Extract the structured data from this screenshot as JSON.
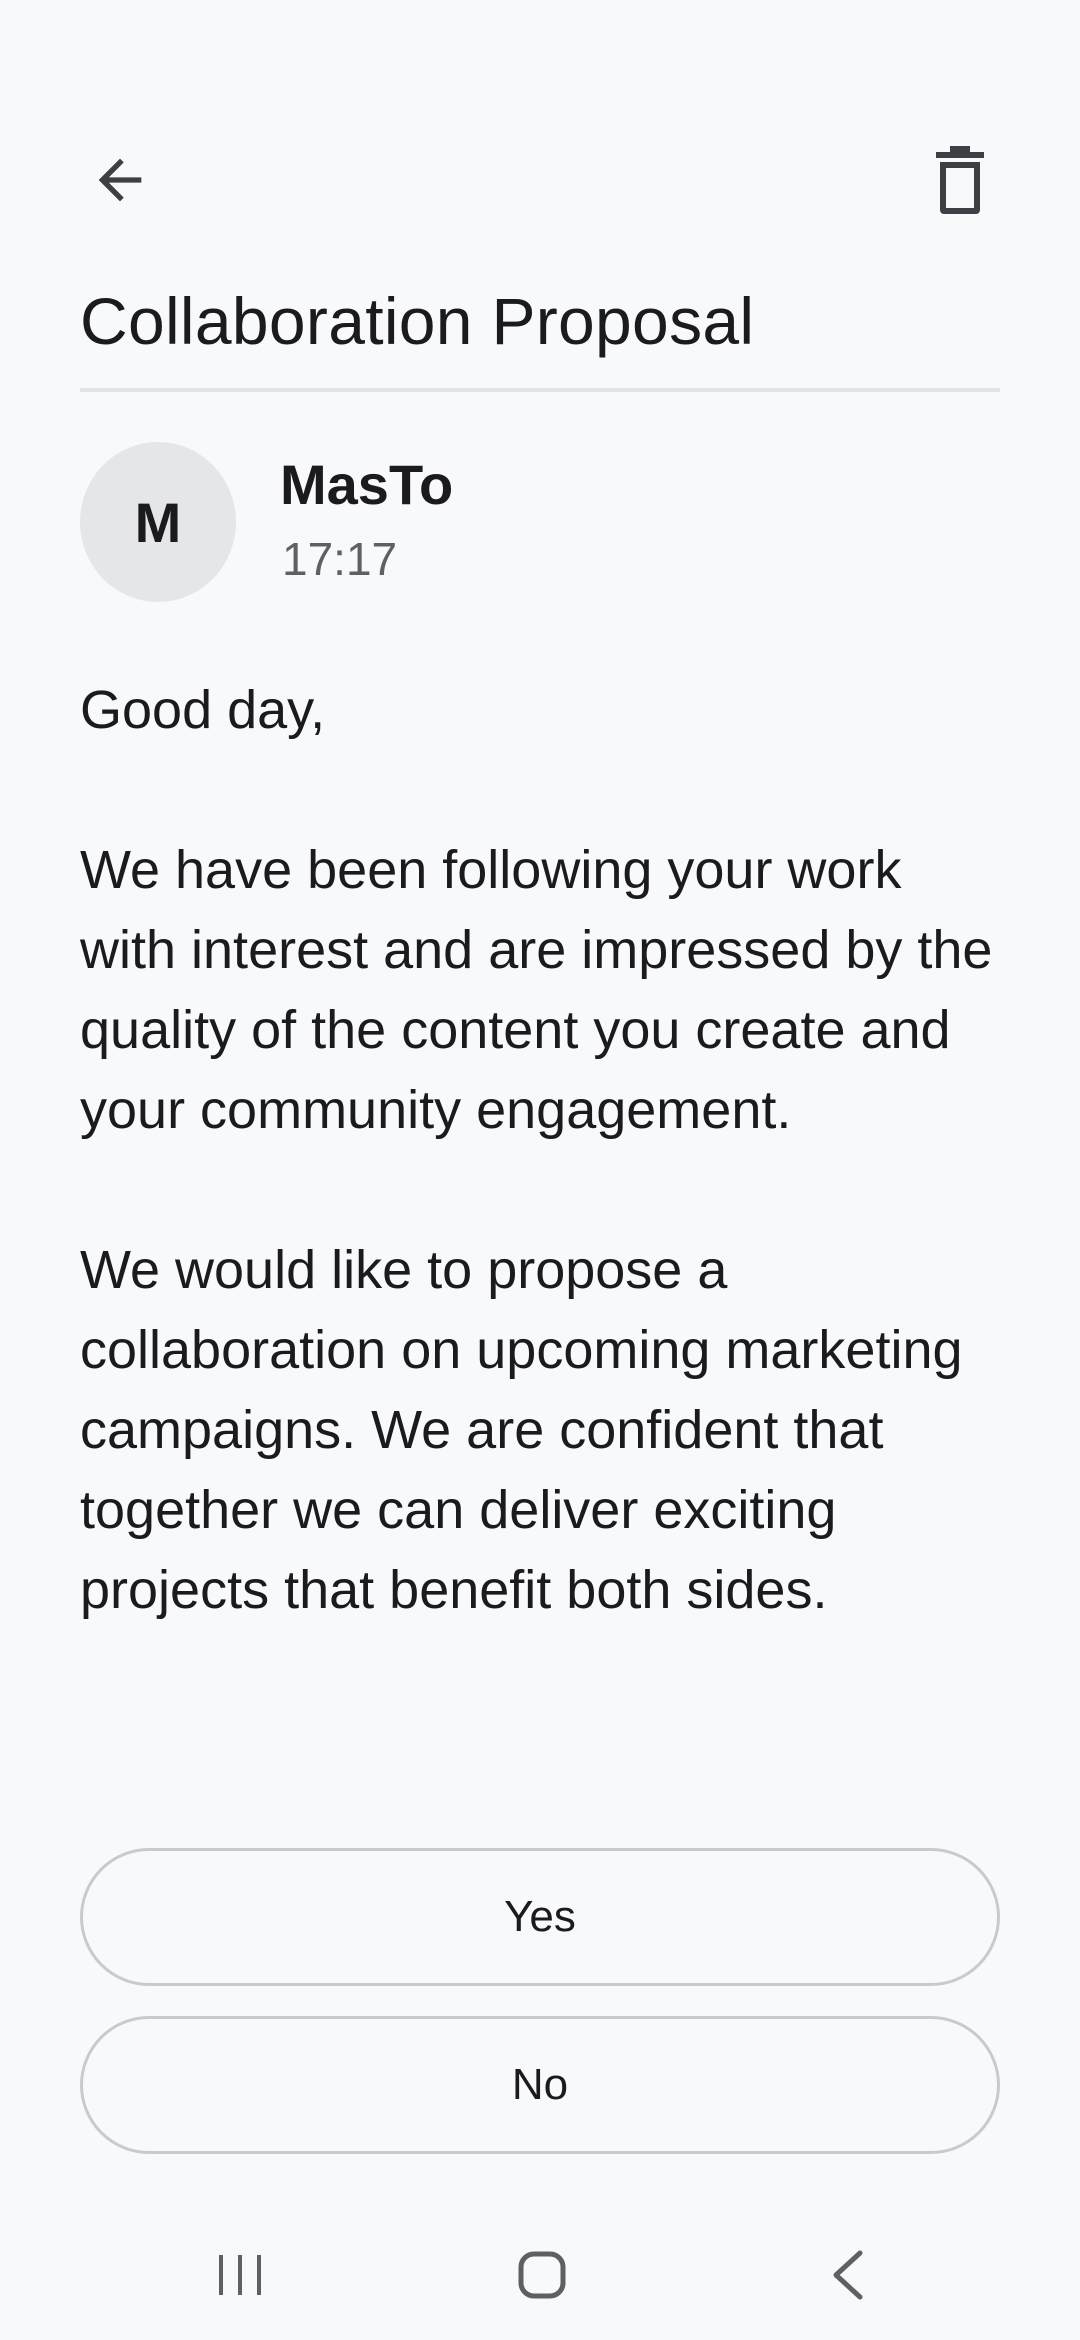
{
  "toolbar": {
    "back_icon": "arrow-left-icon",
    "delete_icon": "trash-icon"
  },
  "email": {
    "subject": "Collaboration Proposal",
    "sender": {
      "initial": "M",
      "name": "MasTo",
      "time": "17:17"
    },
    "body": [
      "Good day,",
      "We have been following your work with interest and are impressed by the quality of the content you create and your community engagement.",
      "We would like to propose a collaboration on upcoming marketing campaigns. We are confident that together we can deliver exciting projects that benefit both sides."
    ]
  },
  "actions": {
    "yes_label": "Yes",
    "no_label": "No"
  },
  "system_nav": {
    "recents_icon": "recents-icon",
    "home_icon": "home-icon",
    "back_icon": "nav-back-icon"
  },
  "colors": {
    "background": "#f8f9fb",
    "text": "#1b1b1f",
    "muted_text": "#5f6066",
    "avatar_bg": "#e5e6ea",
    "divider": "#e2e3e6",
    "button_border": "#c9cacf",
    "icon": "#3c3f44"
  }
}
